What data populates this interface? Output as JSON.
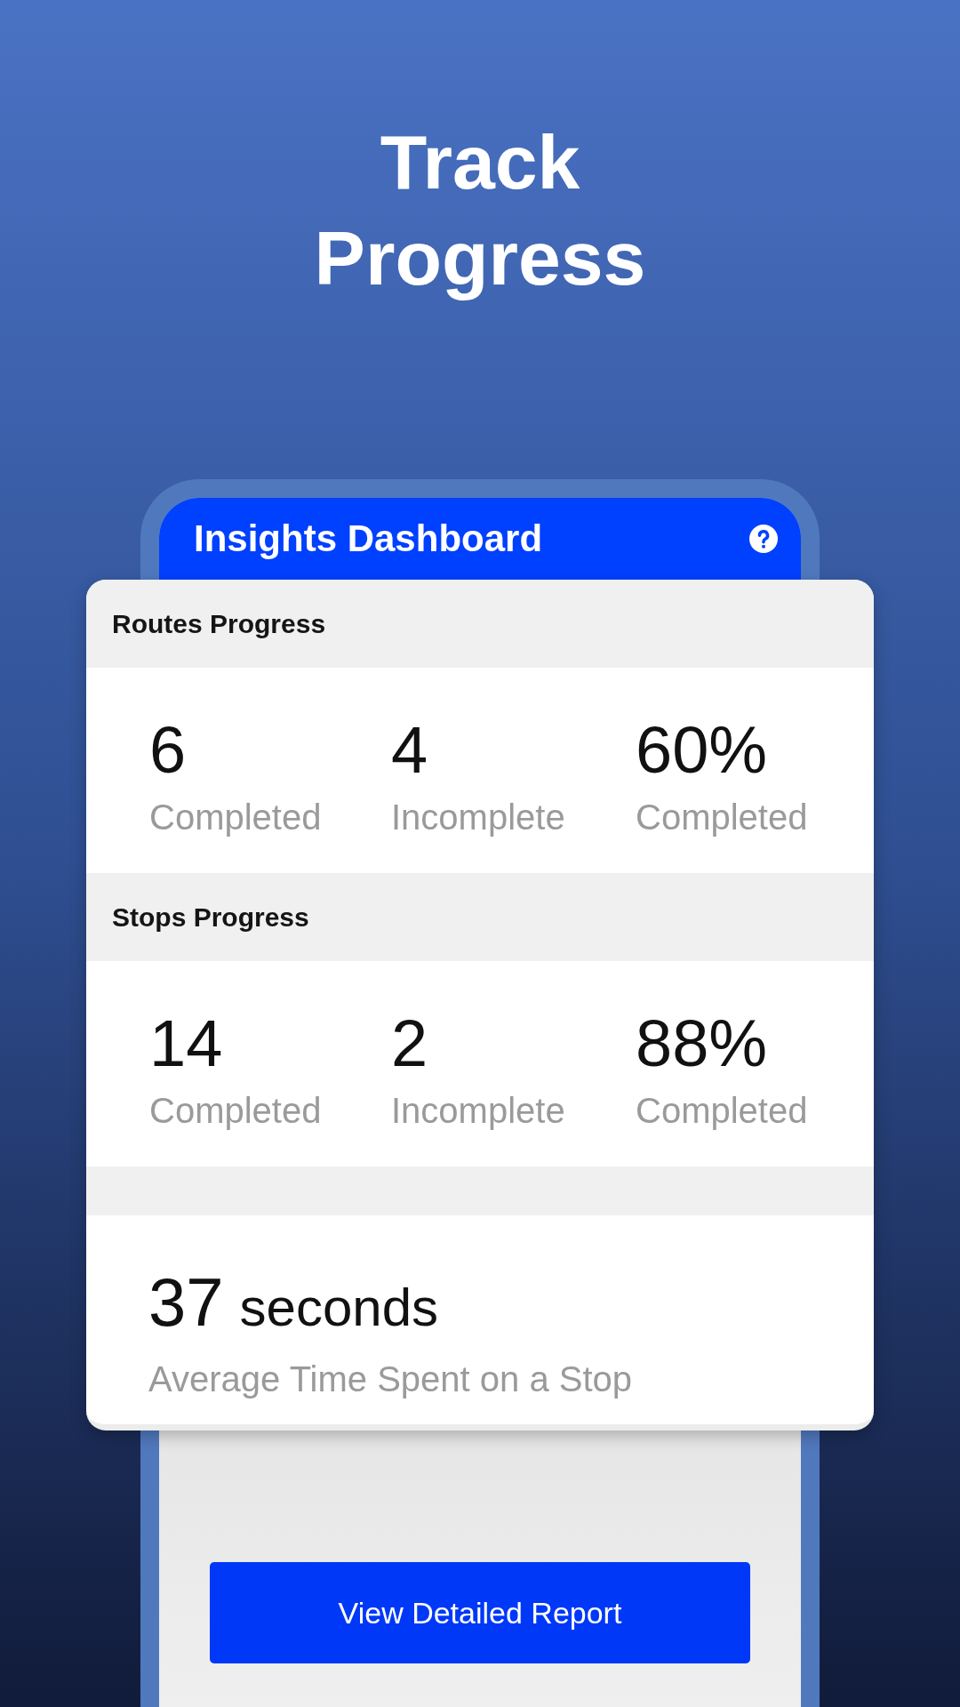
{
  "title": "Track Progress",
  "header": {
    "title": "Insights Dashboard"
  },
  "sections": [
    {
      "kind": "stats",
      "heading": "Routes Progress",
      "stats": [
        {
          "value": "6",
          "label": "Completed"
        },
        {
          "value": "4",
          "label": "Incomplete"
        },
        {
          "value": "60%",
          "label": "Completed"
        }
      ]
    },
    {
      "kind": "stats",
      "heading": "Stops Progress",
      "stats": [
        {
          "value": "14",
          "label": "Completed"
        },
        {
          "value": "2",
          "label": "Incomplete"
        },
        {
          "value": "88%",
          "label": "Completed"
        }
      ]
    },
    {
      "kind": "average",
      "value": "37",
      "unit": "seconds",
      "label": "Average Time Spent on a Stop"
    }
  ],
  "button": {
    "label": "View Detailed Report"
  }
}
